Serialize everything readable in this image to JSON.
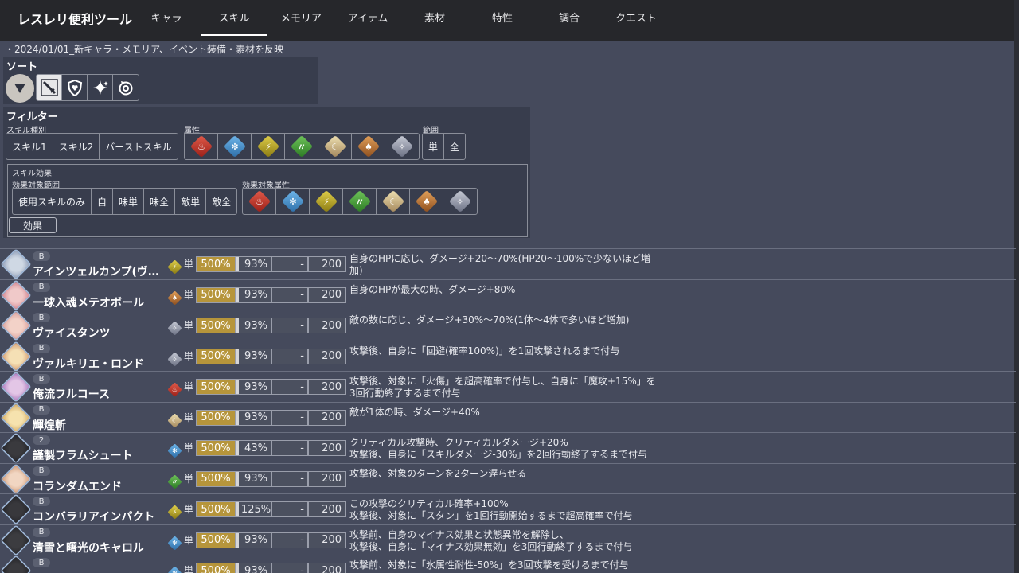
{
  "app": {
    "title": "レスレリ便利ツール"
  },
  "nav": {
    "tabs": [
      {
        "label": "キャラ"
      },
      {
        "label": "スキル",
        "active": true
      },
      {
        "label": "メモリア"
      },
      {
        "label": "アイテム"
      },
      {
        "label": "素材"
      },
      {
        "label": "特性"
      },
      {
        "label": "調合"
      },
      {
        "label": "クエスト"
      }
    ]
  },
  "notice": "・2024/01/01_新キャラ・メモリア、イベント装備・素材を反映",
  "sort": {
    "title": "ソート",
    "direction_icon": "sort-descending-icon",
    "options": [
      {
        "icon": "sword-icon",
        "selected": true
      },
      {
        "icon": "shield-heart-icon",
        "selected": false
      },
      {
        "icon": "sparkle-icon",
        "selected": false
      },
      {
        "icon": "cycle-icon",
        "selected": false
      }
    ]
  },
  "filter": {
    "title": "フィルター",
    "skill_type_label": "スキル種別",
    "skill_types": [
      "スキル1",
      "スキル2",
      "バーストスキル"
    ],
    "attribute_label": "属性",
    "attributes": [
      "fire",
      "ice",
      "thunder",
      "wind",
      "light",
      "dark",
      "none"
    ],
    "range_label": "範囲",
    "ranges": [
      "単",
      "全"
    ],
    "effect": {
      "label": "スキル効果",
      "target_range_label": "効果対象範囲",
      "target_ranges": [
        "使用スキルのみ",
        "自",
        "味単",
        "味全",
        "敵単",
        "敵全"
      ],
      "target_attr_label": "効果対象属性",
      "target_attrs": [
        "fire",
        "ice",
        "thunder",
        "wind",
        "light",
        "dark",
        "none"
      ],
      "button_label": "効果"
    }
  },
  "element_colors": {
    "fire": "#c8392b",
    "ice": "#4a90cf",
    "thunder": "#c9b52c",
    "wind": "#4aa83c",
    "light": "#d8c694",
    "dark": "#c9782f",
    "none": "#a7acba"
  },
  "skills": [
    {
      "rank": "B",
      "name": "アインツェルカンプ(ヴ…",
      "element": "thunder",
      "range": "単",
      "power": "500%",
      "accuracy": "93%",
      "accuracy_pct": 93,
      "extra": "-",
      "cost": "200",
      "desc": [
        "自身のHPに応じ、ダメージ+20〜70%(HP20〜100%で少ないほど増",
        "加)"
      ],
      "avatar": [
        "#cfd8e4",
        "#7b8aa8"
      ]
    },
    {
      "rank": "B",
      "name": "一球入魂メテオボール",
      "element": "dark",
      "range": "単",
      "power": "500%",
      "accuracy": "93%",
      "accuracy_pct": 93,
      "extra": "-",
      "cost": "200",
      "desc": [
        "自身のHPが最大の時、ダメージ+80%"
      ],
      "avatar": [
        "#f0c9c9",
        "#c86b7a"
      ]
    },
    {
      "rank": "B",
      "name": "ヴァイスタンツ",
      "element": "none",
      "range": "単",
      "power": "500%",
      "accuracy": "93%",
      "accuracy_pct": 93,
      "extra": "-",
      "cost": "200",
      "desc": [
        "敵の数に応じ、ダメージ+30%〜70%(1体〜4体で多いほど増加)"
      ],
      "avatar": [
        "#f3d2c8",
        "#d08c8a"
      ]
    },
    {
      "rank": "B",
      "name": "ヴァルキリエ・ロンド",
      "element": "none",
      "range": "単",
      "power": "500%",
      "accuracy": "93%",
      "accuracy_pct": 93,
      "extra": "-",
      "cost": "200",
      "desc": [
        "攻撃後、自身に「回避(確率100%)」を1回攻撃されるまで付与"
      ],
      "avatar": [
        "#f5e0b5",
        "#c9845a"
      ]
    },
    {
      "rank": "B",
      "name": "俺流フルコース",
      "element": "fire",
      "range": "単",
      "power": "500%",
      "accuracy": "93%",
      "accuracy_pct": 93,
      "extra": "-",
      "cost": "200",
      "desc": [
        "攻撃後、対象に「火傷」を超高確率で付与し、自身に「魔攻+15%」を",
        "3回行動終了するまで付与"
      ],
      "avatar": [
        "#e3c6e6",
        "#9a5fb0"
      ]
    },
    {
      "rank": "B",
      "name": "輝煌斬",
      "element": "light",
      "range": "単",
      "power": "500%",
      "accuracy": "93%",
      "accuracy_pct": 93,
      "extra": "-",
      "cost": "200",
      "desc": [
        "敵が1体の時、ダメージ+40%"
      ],
      "avatar": [
        "#f6e2ae",
        "#c99a4c"
      ]
    },
    {
      "rank": "2",
      "name": "謹製フラムシュート",
      "element": "ice",
      "range": "単",
      "power": "500%",
      "accuracy": "43%",
      "accuracy_pct": 43,
      "extra": "-",
      "cost": "200",
      "desc": [
        "クリティカル攻撃時、クリティカルダメージ+20%",
        "攻撃後、自身に「スキルダメージ-30%」を2回行動終了するまで付与"
      ],
      "avatar": [
        "#3a3a3e",
        "#1c1c20"
      ]
    },
    {
      "rank": "B",
      "name": "コランダムエンド",
      "element": "wind",
      "range": "単",
      "power": "500%",
      "accuracy": "93%",
      "accuracy_pct": 93,
      "extra": "-",
      "cost": "200",
      "desc": [
        "攻撃後、対象のターンを2ターン遅らせる"
      ],
      "avatar": [
        "#f1d6c2",
        "#c7875e"
      ]
    },
    {
      "rank": "B",
      "name": "コンバラリアインパクト",
      "element": "thunder",
      "range": "単",
      "power": "500%",
      "accuracy": "125%",
      "accuracy_pct": 100,
      "extra": "-",
      "cost": "200",
      "desc": [
        "この攻撃のクリティカル確率+100%",
        "攻撃後、対象に「スタン」を1回行動開始するまで超高確率で付与"
      ],
      "avatar": [
        "#38383c",
        "#1a1a1e"
      ]
    },
    {
      "rank": "B",
      "name": "清雪と曙光のキャロル",
      "element": "ice",
      "range": "単",
      "power": "500%",
      "accuracy": "93%",
      "accuracy_pct": 93,
      "extra": "-",
      "cost": "200",
      "desc": [
        "攻撃前、自身のマイナス効果と状態異常を解除し、",
        "攻撃後、自身に「マイナス効果無効」を3回行動終了するまで付与"
      ],
      "avatar": [
        "#3c3c40",
        "#1e1e22"
      ]
    },
    {
      "rank": "B",
      "name": "",
      "element": "ice",
      "range": "単",
      "power": "500%",
      "accuracy": "93%",
      "accuracy_pct": 93,
      "extra": "-",
      "cost": "200",
      "desc": [
        "攻撃前、対象に「氷属性耐性-50%」を3回攻撃を受けるまで付与"
      ],
      "avatar": [
        "#3a3a3e",
        "#1c1c20"
      ]
    }
  ]
}
